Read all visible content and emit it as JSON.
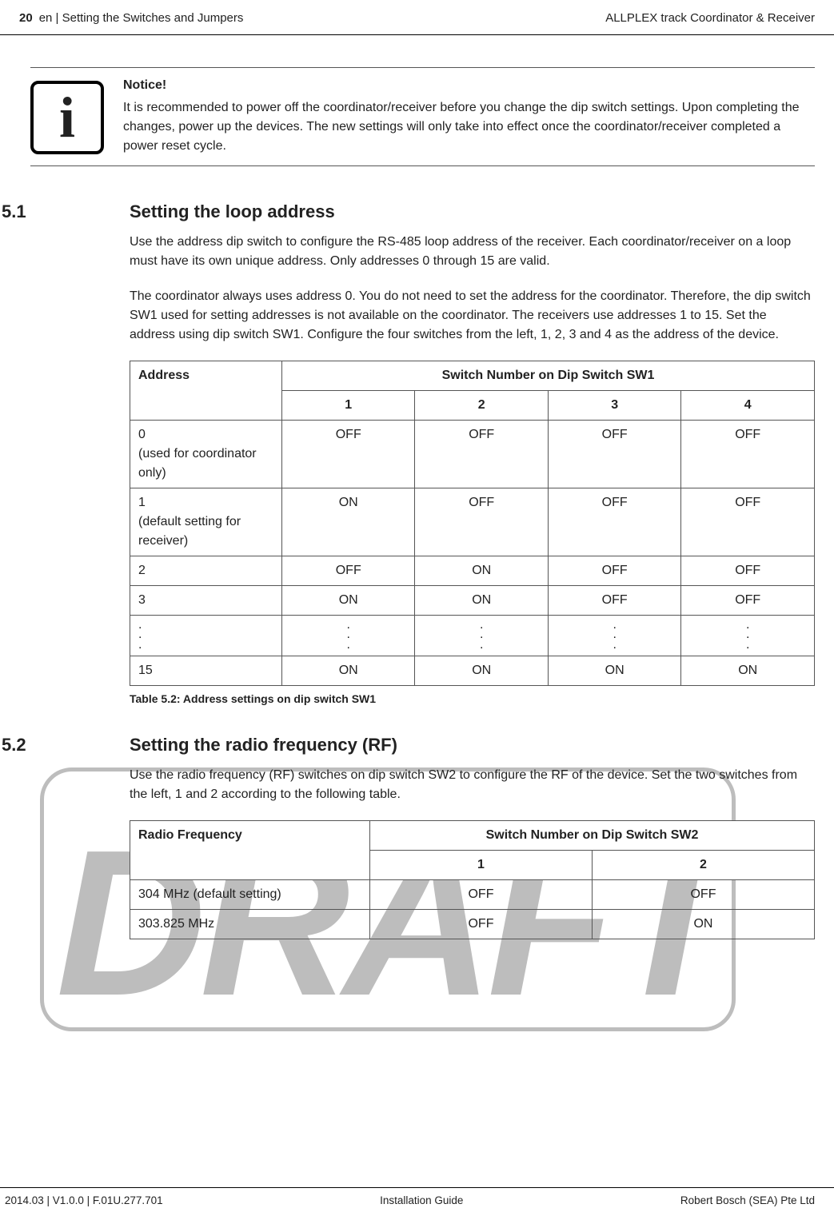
{
  "header": {
    "page_number": "20",
    "left_title": "en | Setting the Switches and Jumpers",
    "right_title": "ALLPLEX track Coordinator & Receiver"
  },
  "watermark": "DRAFT",
  "notice": {
    "heading": "Notice!",
    "body": "It is recommended to power off the coordinator/receiver before you change the dip switch settings. Upon completing the changes, power up the devices. The new settings will only take into effect once the coordinator/receiver completed a power reset cycle."
  },
  "sections": {
    "s51": {
      "number": "5.1",
      "title": "Setting the loop address",
      "p1": "Use the address dip switch to configure the RS-485 loop address of the receiver. Each coordinator/receiver on a loop must have its own unique address. Only addresses 0 through 15 are valid.",
      "p2": "The coordinator always uses address 0. You do not need to set the address for the coordinator. Therefore, the dip switch SW1 used for setting addresses is not available on the coordinator. The receivers use addresses 1 to 15. Set the address using dip switch SW1. Configure the four switches from the left, 1, 2, 3 and 4 as the address of the device."
    },
    "s52": {
      "number": "5.2",
      "title": "Setting the radio frequency (RF)",
      "p1": "Use the radio frequency (RF) switches on dip switch SW2 to configure the RF of the device. Set the two switches from the left, 1 and 2 according to the following table."
    }
  },
  "table51": {
    "col_addr": "Address",
    "col_group": "Switch Number on Dip Switch SW1",
    "cols": {
      "c1": "1",
      "c2": "2",
      "c3": "3",
      "c4": "4"
    },
    "rows": {
      "r0": {
        "addr_line1": "0",
        "addr_line2": "(used for coordinator only)",
        "v1": "OFF",
        "v2": "OFF",
        "v3": "OFF",
        "v4": "OFF"
      },
      "r1": {
        "addr_line1": "1",
        "addr_line2": "(default setting for receiver)",
        "v1": "ON",
        "v2": "OFF",
        "v3": "OFF",
        "v4": "OFF"
      },
      "r2": {
        "addr": "2",
        "v1": "OFF",
        "v2": "ON",
        "v3": "OFF",
        "v4": "OFF"
      },
      "r3": {
        "addr": "3",
        "v1": "ON",
        "v2": "ON",
        "v3": "OFF",
        "v4": "OFF"
      },
      "rdots": {
        "addr": ".",
        "v": "."
      },
      "r15": {
        "addr": "15",
        "v1": "ON",
        "v2": "ON",
        "v3": "ON",
        "v4": "ON"
      }
    },
    "caption": "Table 5.2: Address settings on dip switch SW1"
  },
  "table52": {
    "col_rf": "Radio Frequency",
    "col_group": "Switch Number on Dip Switch SW2",
    "cols": {
      "c1": "1",
      "c2": "2"
    },
    "rows": {
      "r0": {
        "rf": "304 MHz (default setting)",
        "v1": "OFF",
        "v2": "OFF"
      },
      "r1": {
        "rf": "303.825 MHz",
        "v1": "OFF",
        "v2": "ON"
      }
    }
  },
  "footer": {
    "left": "2014.03 | V1.0.0 | F.01U.277.701",
    "center": "Installation Guide",
    "right": "Robert Bosch (SEA) Pte Ltd"
  }
}
